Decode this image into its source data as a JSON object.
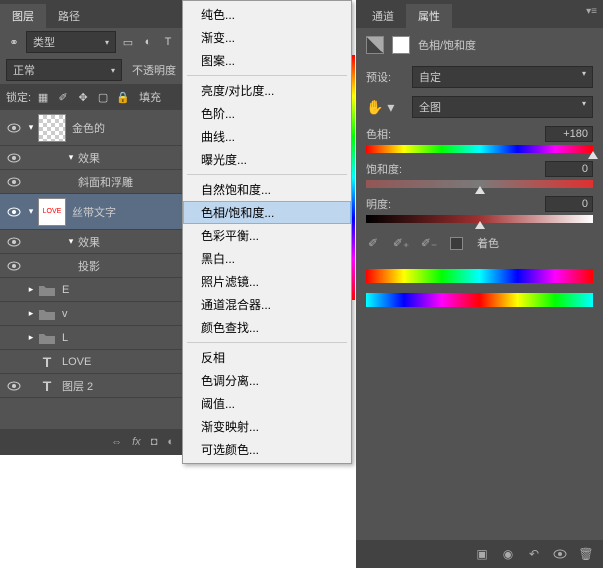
{
  "layers": {
    "tabs": {
      "layers": "图层",
      "paths": "路径"
    },
    "filter": {
      "label": "类型"
    },
    "blend": {
      "mode": "正常",
      "opacity_label": "不透明度"
    },
    "lock": {
      "label": "锁定:",
      "fill_label": "填充"
    },
    "items": {
      "gold": {
        "name": "金色的"
      },
      "effects1": "效果",
      "bevel": "斜面和浮雕",
      "ribbon": {
        "name": "丝带文字",
        "thumb_text": "LOVE"
      },
      "effects2": "效果",
      "shadow": "投影",
      "grpE": "E",
      "grpV": "v",
      "grpL": "L",
      "love": "LOVE",
      "layer2": "图层 2"
    }
  },
  "menu": {
    "items": [
      "纯色...",
      "渐变...",
      "图案...",
      "-",
      "亮度/对比度...",
      "色阶...",
      "曲线...",
      "曝光度...",
      "-",
      "自然饱和度...",
      "色相/饱和度...",
      "色彩平衡...",
      "黑白...",
      "照片滤镜...",
      "通道混合器...",
      "颜色查找...",
      "-",
      "反相",
      "色调分离...",
      "阈值...",
      "渐变映射...",
      "可选颜色..."
    ],
    "highlighted": "色相/饱和度..."
  },
  "props": {
    "tabs": {
      "channels": "通道",
      "properties": "属性"
    },
    "title": "色相/饱和度",
    "preset": {
      "label": "预设:",
      "value": "自定"
    },
    "channel": {
      "value": "全图"
    },
    "hue": {
      "label": "色相:",
      "value": "+180",
      "pos": 100
    },
    "sat": {
      "label": "饱和度:",
      "value": "0",
      "pos": 50
    },
    "light": {
      "label": "明度:",
      "value": "0",
      "pos": 50
    },
    "colorize": "着色"
  }
}
